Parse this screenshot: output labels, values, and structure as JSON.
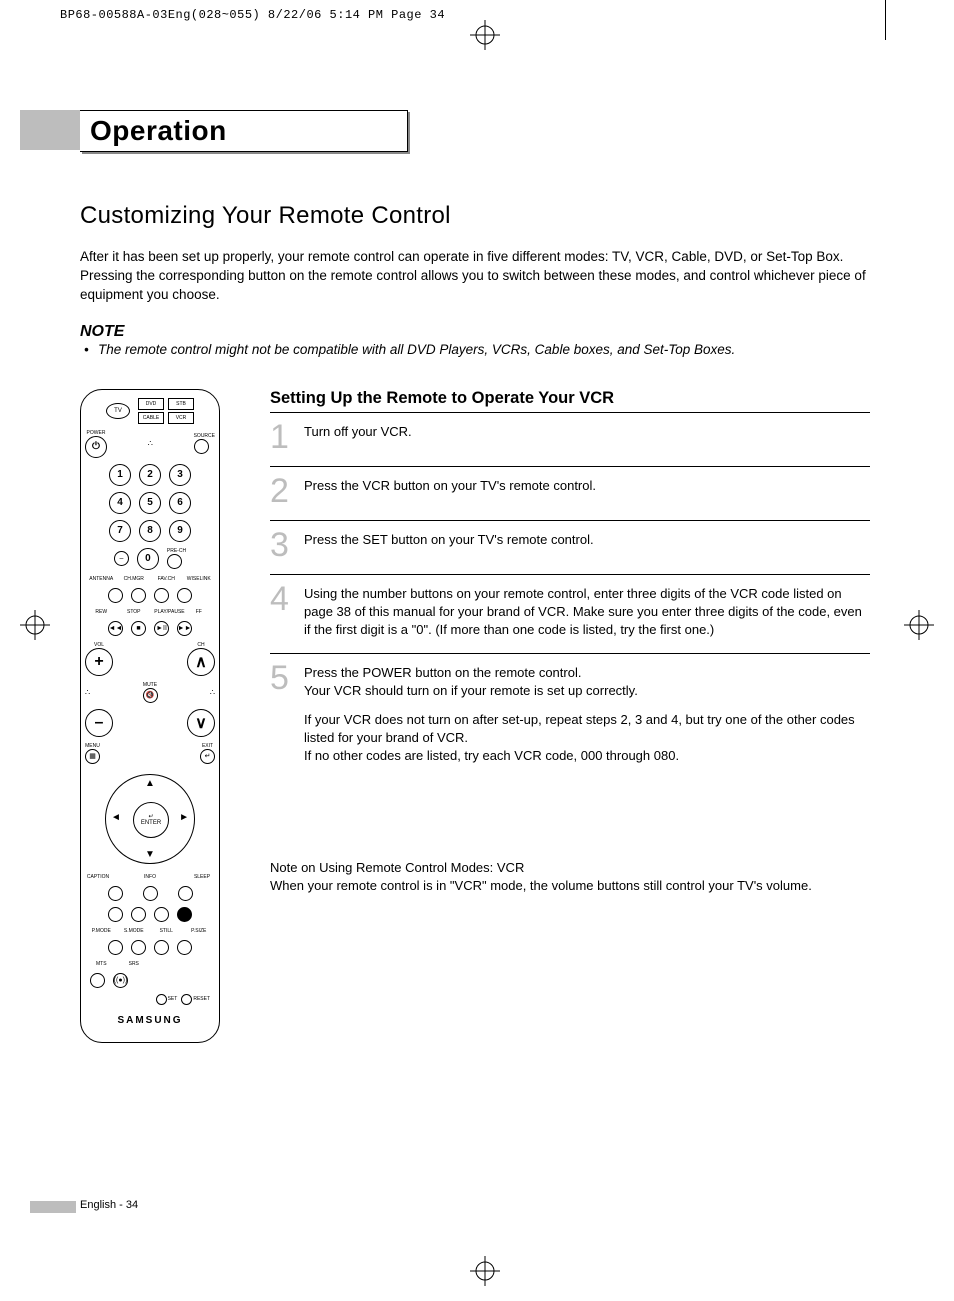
{
  "crop": {
    "header": "BP68-00588A-03Eng(028~055)  8/22/06  5:14 PM  Page 34"
  },
  "banner": {
    "title": "Operation"
  },
  "subtitle": "Customizing Your Remote Control",
  "intro": "After it has been set up properly, your remote control can operate in five different modes: TV, VCR, Cable, DVD, or Set-Top Box. Pressing the corresponding button on the remote control allows you to switch between these modes, and control whichever piece of equipment you choose.",
  "note": {
    "head": "NOTE",
    "body": "The remote control might not be compatible with all DVD Players, VCRs, Cable boxes, and Set-Top Boxes."
  },
  "remote": {
    "tv": "TV",
    "dvd": "DVD",
    "stb": "STB",
    "cable": "CABLE",
    "vcr": "VCR",
    "power": "POWER",
    "source": "SOURCE",
    "n1": "1",
    "n2": "2",
    "n3": "3",
    "n4": "4",
    "n5": "5",
    "n6": "6",
    "n7": "7",
    "n8": "8",
    "n9": "9",
    "n0": "0",
    "dash": "–",
    "prech": "PRE-CH",
    "antenna": "ANTENNA",
    "chmgr": "CH.MGR",
    "favch": "FAV.CH",
    "wiselink": "WISELINK",
    "rew": "REW",
    "stop": "STOP",
    "play": "PLAY/PAUSE",
    "ff": "FF",
    "vol": "VOL",
    "ch": "CH",
    "mute": "MUTE",
    "menu": "MENU",
    "exit": "EXIT",
    "enter": "ENTER",
    "caption": "CAPTION",
    "info": "INFO",
    "sleep": "SLEEP",
    "pmode": "P.MODE",
    "smode": "S.MODE",
    "still": "STILL",
    "psize": "P.SIZE",
    "mts": "MTS",
    "srs": "SRS",
    "set": "SET",
    "reset": "RESET",
    "brand": "SAMSUNG"
  },
  "steps_title": "Setting Up the Remote to Operate Your VCR",
  "steps": {
    "s1": {
      "num": "1",
      "text": "Turn off your VCR."
    },
    "s2": {
      "num": "2",
      "text": "Press the VCR button on your TV's remote control."
    },
    "s3": {
      "num": "3",
      "text": "Press the SET button on your TV's remote control."
    },
    "s4": {
      "num": "4",
      "text": "Using the number buttons on your remote control, enter three digits of the VCR code listed on page 38 of this manual for your brand of VCR. Make sure you enter three digits of the code, even if the first digit is a \"0\". (If more than one code is listed, try the first one.)"
    },
    "s5": {
      "num": "5",
      "p1": "Press the POWER button on the remote control.\nYour VCR should turn on if your remote is set up correctly.",
      "p2": "If your VCR does not turn on after set-up, repeat steps 2, 3 and 4, but try one of the other codes listed for your brand of VCR.\nIf no other codes are listed, try each VCR code, 000 through 080."
    }
  },
  "mode_note": "Note on Using Remote Control Modes: VCR\nWhen your remote control is in \"VCR\" mode, the volume buttons still control your TV's volume.",
  "footer": "English - 34"
}
